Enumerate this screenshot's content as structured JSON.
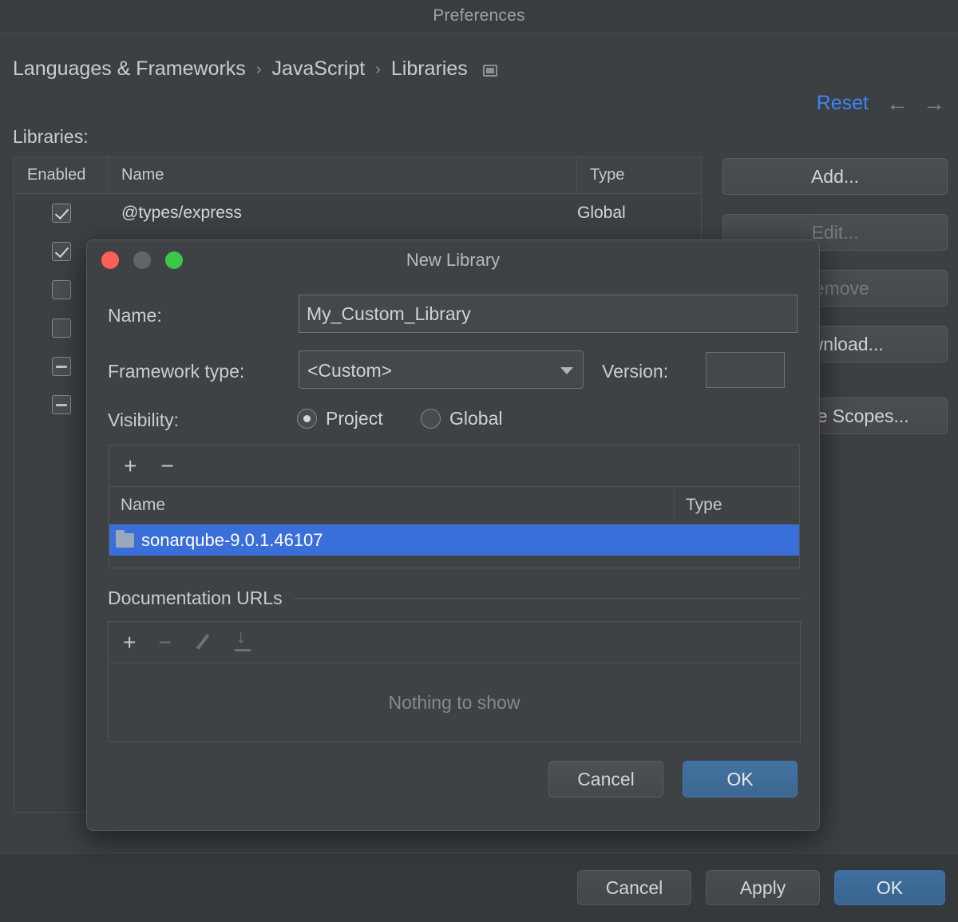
{
  "window": {
    "title": "Preferences"
  },
  "breadcrumb": {
    "items": [
      "Languages & Frameworks",
      "JavaScript",
      "Libraries"
    ],
    "separator": "›",
    "panel_icon": "panel-toggle-icon",
    "reset_label": "Reset",
    "back_icon": "←",
    "forward_icon": "→"
  },
  "libraries_section": {
    "label": "Libraries:",
    "columns": [
      "Enabled",
      "Name",
      "Type"
    ],
    "rows": [
      {
        "enabled": "checked",
        "name": "@types/express",
        "type": "Global"
      },
      {
        "enabled": "checked",
        "name": "",
        "type": ""
      },
      {
        "enabled": "unchecked",
        "name": "",
        "type": ""
      },
      {
        "enabled": "unchecked",
        "name": "",
        "type": ""
      },
      {
        "enabled": "indeterminate",
        "name": "",
        "type": ""
      },
      {
        "enabled": "indeterminate",
        "name": "",
        "type": ""
      }
    ],
    "side_buttons": [
      {
        "label": "Add...",
        "enabled": true
      },
      {
        "label": "Edit...",
        "enabled": false
      },
      {
        "label": "Remove",
        "enabled": false
      },
      {
        "label": "Download...",
        "enabled": true
      },
      {
        "label": "Manage Scopes...",
        "enabled": true
      }
    ]
  },
  "prefs_footer": {
    "cancel_label": "Cancel",
    "apply_label": "Apply",
    "ok_label": "OK"
  },
  "new_library_dialog": {
    "title": "New Library",
    "traffic_lights": [
      "close-button",
      "minimize-button",
      "zoom-button"
    ],
    "name_label": "Name:",
    "name_value": "My_Custom_Library",
    "name_placeholder": "",
    "framework_label": "Framework type:",
    "framework_value": "<Custom>",
    "framework_options": [
      "<Custom>"
    ],
    "version_label": "Version:",
    "version_value": "",
    "version_placeholder": "",
    "visibility_label": "Visibility:",
    "visibility_options": [
      {
        "label": "Project",
        "selected": true
      },
      {
        "label": "Global",
        "selected": false
      }
    ],
    "files_toolbar": [
      {
        "icon": "plus-icon",
        "glyph": "+",
        "enabled": true
      },
      {
        "icon": "minus-icon",
        "glyph": "−",
        "enabled": true
      }
    ],
    "files_columns": [
      "Name",
      "Type"
    ],
    "files_rows": [
      {
        "name": "sonarqube-9.0.1.46107",
        "type": "",
        "icon": "folder-icon",
        "selected": true
      }
    ],
    "documentation": {
      "legend": "Documentation URLs",
      "toolbar": [
        {
          "icon": "plus-icon",
          "glyph": "+",
          "enabled": true
        },
        {
          "icon": "minus-icon",
          "glyph": "−",
          "enabled": false
        },
        {
          "icon": "pencil-icon",
          "glyph": "",
          "enabled": false
        },
        {
          "icon": "download-icon",
          "glyph": "",
          "enabled": false
        }
      ],
      "empty_text": "Nothing to show"
    },
    "cancel_label": "Cancel",
    "ok_label": "OK"
  },
  "colors": {
    "window_bg": "#3c4043",
    "dialog_bg": "#3f4245",
    "accent_blue": "#3b86f5",
    "selection_blue": "#3a6ed8",
    "primary_button": "#3f6f9e",
    "text_primary": "#d2d5d8",
    "text_muted": "#85898c"
  }
}
